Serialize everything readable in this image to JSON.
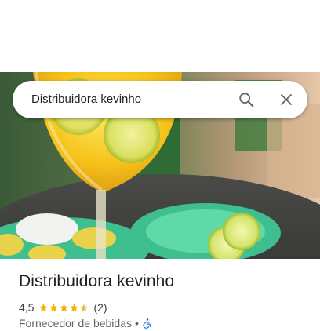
{
  "search": {
    "query": "Distribuidora kevinho",
    "search_icon": "search-icon",
    "close_icon": "close-icon"
  },
  "hero": {
    "image": "photo of a cocktail glass with lime slices and a plate of limes and salt"
  },
  "place": {
    "name": "Distribuidora kevinho",
    "rating": "4,5",
    "rating_value": 4.5,
    "review_count": "(2)",
    "category": "Fornecedor de bebidas",
    "separator": "•",
    "accessibility_icon": "wheelchair-accessible-icon"
  },
  "colors": {
    "star": "#f4b400",
    "star_empty": "#dadce0",
    "accessibility": "#1a73e8",
    "icon_gray": "#5f6368"
  }
}
